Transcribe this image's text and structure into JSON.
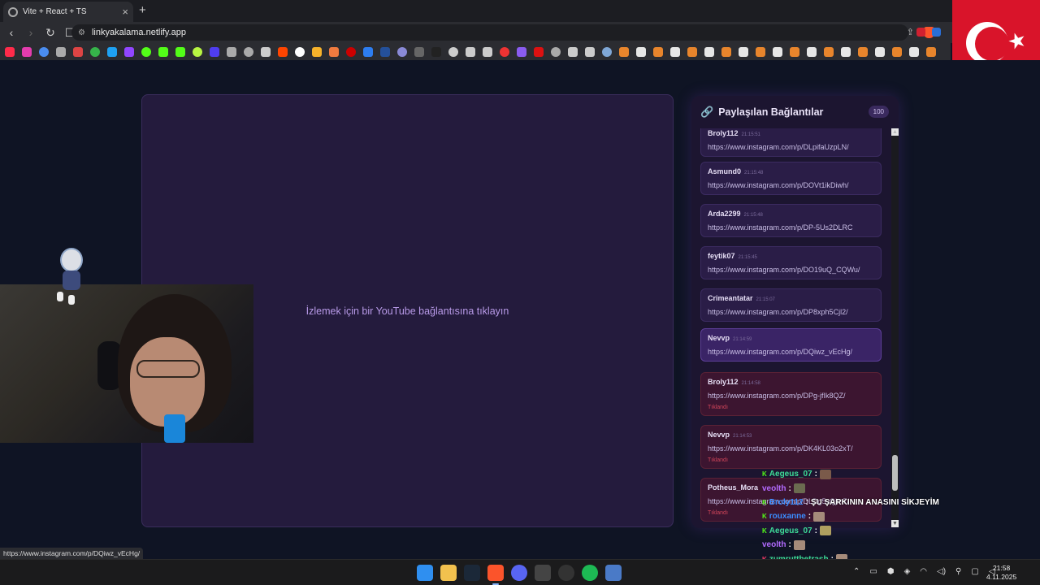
{
  "browser": {
    "tab_title": "Vite + React + TS",
    "tab_close": "×",
    "new_tab": "+",
    "url": "linkyakalama.netlify.app",
    "nav": {
      "back": "‹",
      "forward": "›",
      "reload": "↻",
      "bookmark": "☐"
    }
  },
  "player": {
    "placeholder": "İzlemek için bir YouTube bağlantısına tıklayın"
  },
  "links_panel": {
    "title": "Paylaşılan Bağlantılar",
    "count": "100",
    "items": [
      {
        "user": "Broly112",
        "time": "21:15:51",
        "url": "https://www.instagram.com/p/DLpifaUzpLN/",
        "status": ""
      },
      {
        "user": "Asmund0",
        "time": "21:15:48",
        "url": "https://www.instagram.com/p/DOVt1ikDiwh/",
        "status": ""
      },
      {
        "user": "Arda2299",
        "time": "21:15:48",
        "url": "https://www.instagram.com/p/DP-5Us2DLRC",
        "status": ""
      },
      {
        "user": "feytik07",
        "time": "21:15:45",
        "url": "https://www.instagram.com/p/DO19uQ_CQWu/",
        "status": ""
      },
      {
        "user": "Crimeantatar",
        "time": "21:15:07",
        "url": "https://www.instagram.com/p/DP8xph5Cjl2/",
        "status": ""
      },
      {
        "user": "Nevvp",
        "time": "21:14:59",
        "url": "https://www.instagram.com/p/DQiwz_vEcHg/",
        "status": ""
      },
      {
        "user": "Broly112",
        "time": "21:14:58",
        "url": "https://www.instagram.com/p/DPg-jfIk8QZ/",
        "status": "Tıklandı"
      },
      {
        "user": "Nevvp",
        "time": "21:14:53",
        "url": "https://www.instagram.com/p/DK4KL03o2xT/",
        "status": "Tıklandı"
      },
      {
        "user": "Potheus_Mora",
        "time": "",
        "url": "https://www.instagram.com/p/DLDg5vQjm7/",
        "status": "Tıklandı"
      }
    ]
  },
  "chat": [
    {
      "badge": "K",
      "user": "Aegeus_07",
      "color": "#3ddc97",
      "text": ""
    },
    {
      "badge": "",
      "user": "veolth",
      "color": "#b36bff",
      "text": ""
    },
    {
      "badge": "K",
      "user": "Broly112",
      "color": "#3a8dff",
      "text": "ŞU ŞARKININ ANASINI SİKJEYİM"
    },
    {
      "badge": "K",
      "user": "rouxanne",
      "color": "#3a8dff",
      "text": ""
    },
    {
      "badge": "K",
      "user": "Aegeus_07",
      "color": "#3ddc97",
      "text": ""
    },
    {
      "badge": "",
      "user": "veolth",
      "color": "#b36bff",
      "text": ""
    },
    {
      "badge": "K",
      "user": "zumrutthetrash",
      "color": "#3ddc97",
      "text": ""
    }
  ],
  "status_bar_url": "https://www.instagram.com/p/DQiwz_vEcHg/",
  "taskbar": {
    "time": "21:58",
    "date": "4.11.2025"
  },
  "colors": {
    "page_bg": "#0f1424",
    "player_bg": "#241b3d",
    "accent": "#b89ae8",
    "clicked": "#d2455a",
    "flag_red": "#d9142a"
  }
}
